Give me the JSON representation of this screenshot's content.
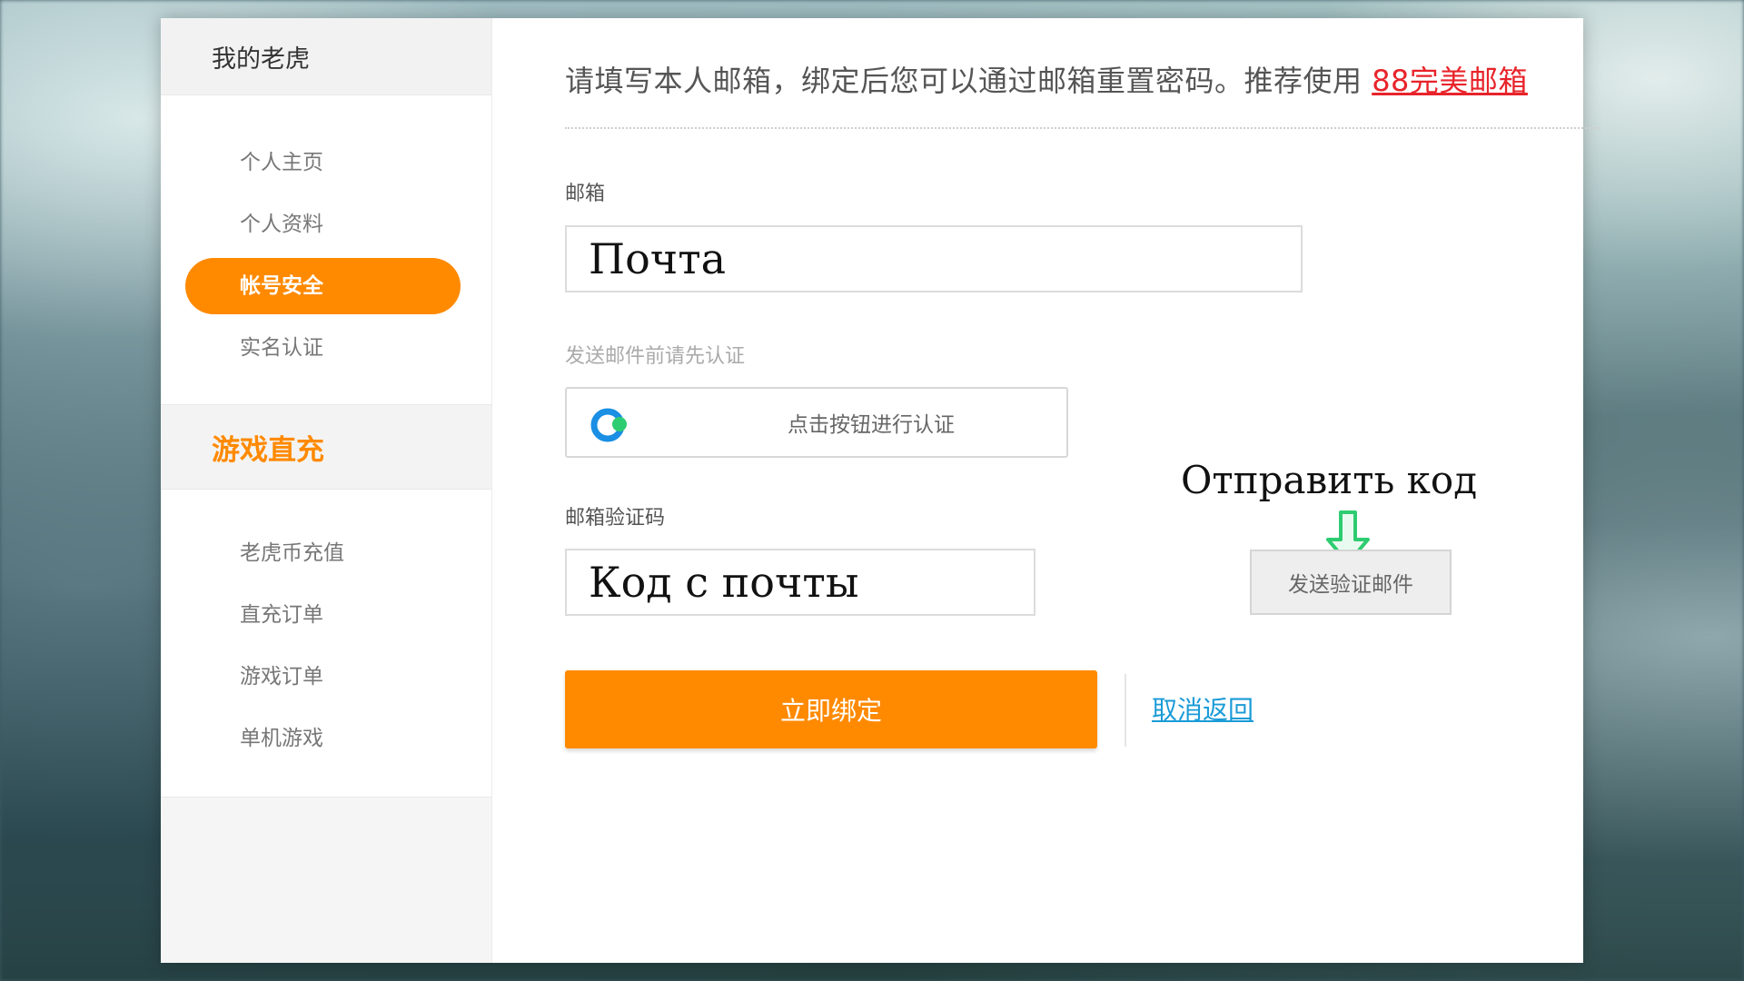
{
  "sidebar": {
    "header": "我的老虎",
    "account_items": [
      {
        "label": "个人主页"
      },
      {
        "label": "个人资料"
      },
      {
        "label": "帐号安全",
        "active": true
      },
      {
        "label": "实名认证"
      }
    ],
    "section_title": "游戏直充",
    "game_items": [
      {
        "label": "老虎币充值"
      },
      {
        "label": "直充订单"
      },
      {
        "label": "游戏订单"
      },
      {
        "label": "单机游戏"
      }
    ]
  },
  "main": {
    "notice_text": "请填写本人邮箱，绑定后您可以通过邮箱重置密码。推荐使用 ",
    "notice_link": "88完美邮箱",
    "email_label": "邮箱",
    "email_value": "Почта",
    "verify_hint": "发送邮件前请先认证",
    "verify_button": "点击按钮进行认证",
    "code_label": "邮箱验证码",
    "code_value": "Код с почты",
    "send_button": "发送验证邮件",
    "annotation": "Отправить код",
    "submit_button": "立即绑定",
    "cancel_link": "取消返回"
  },
  "colors": {
    "accent": "#ff8a00",
    "link_red": "#e8232a",
    "link_blue": "#1a9bd7",
    "annotation_arrow": "#2ecc71"
  },
  "icons": {
    "verify_logo": "captcha-logo-icon",
    "annotation_arrow": "arrow-down-icon"
  }
}
